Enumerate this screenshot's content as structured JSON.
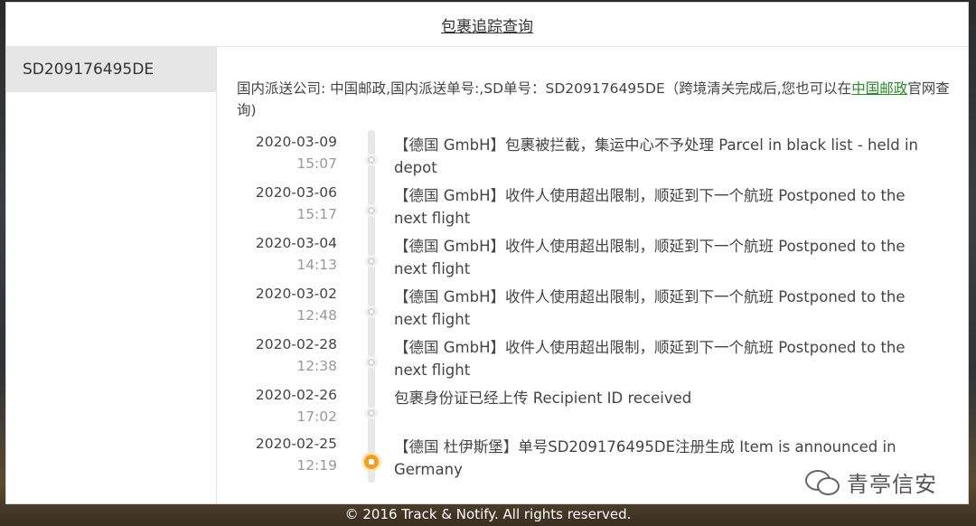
{
  "header": {
    "title": "包裹追踪查询"
  },
  "sidebar": {
    "items": [
      {
        "label": "SD209176495DE"
      }
    ]
  },
  "info": {
    "prefix": "国内派送公司: 中国邮政,国内派送单号:,SD单号：SD209176495DE（跨境清关完成后,您也可以在",
    "link": "中国邮政",
    "suffix": "官网查询)"
  },
  "events": [
    {
      "date": "2020-03-09",
      "time": "15:07",
      "desc": "【德国 GmbH】包裹被拦截，集运中心不予处理 Parcel in black list - held in depot",
      "active": false
    },
    {
      "date": "2020-03-06",
      "time": "15:17",
      "desc": "【德国 GmbH】收件人使用超出限制，顺延到下一个航班 Postponed to the next flight",
      "active": false
    },
    {
      "date": "2020-03-04",
      "time": "14:13",
      "desc": "【德国 GmbH】收件人使用超出限制，顺延到下一个航班 Postponed to the next flight",
      "active": false
    },
    {
      "date": "2020-03-02",
      "time": "12:48",
      "desc": "【德国 GmbH】收件人使用超出限制，顺延到下一个航班 Postponed to the next flight",
      "active": false
    },
    {
      "date": "2020-02-28",
      "time": "12:38",
      "desc": "【德国 GmbH】收件人使用超出限制，顺延到下一个航班 Postponed to the next flight",
      "active": false
    },
    {
      "date": "2020-02-26",
      "time": "17:02",
      "desc": "包裹身份证已经上传 Recipient ID received",
      "active": false
    },
    {
      "date": "2020-02-25",
      "time": "12:19",
      "desc": "【德国 杜伊斯堡】单号SD209176495DE注册生成 Item is announced in Germany",
      "active": true
    }
  ],
  "watermark": {
    "text": "青亭信安",
    "icon": "wechat-icon"
  },
  "footer": {
    "text": "© 2016 Track & Notify. All rights reserved."
  },
  "colors": {
    "link": "#2a8a2a",
    "active_dot": "#f0a020"
  }
}
